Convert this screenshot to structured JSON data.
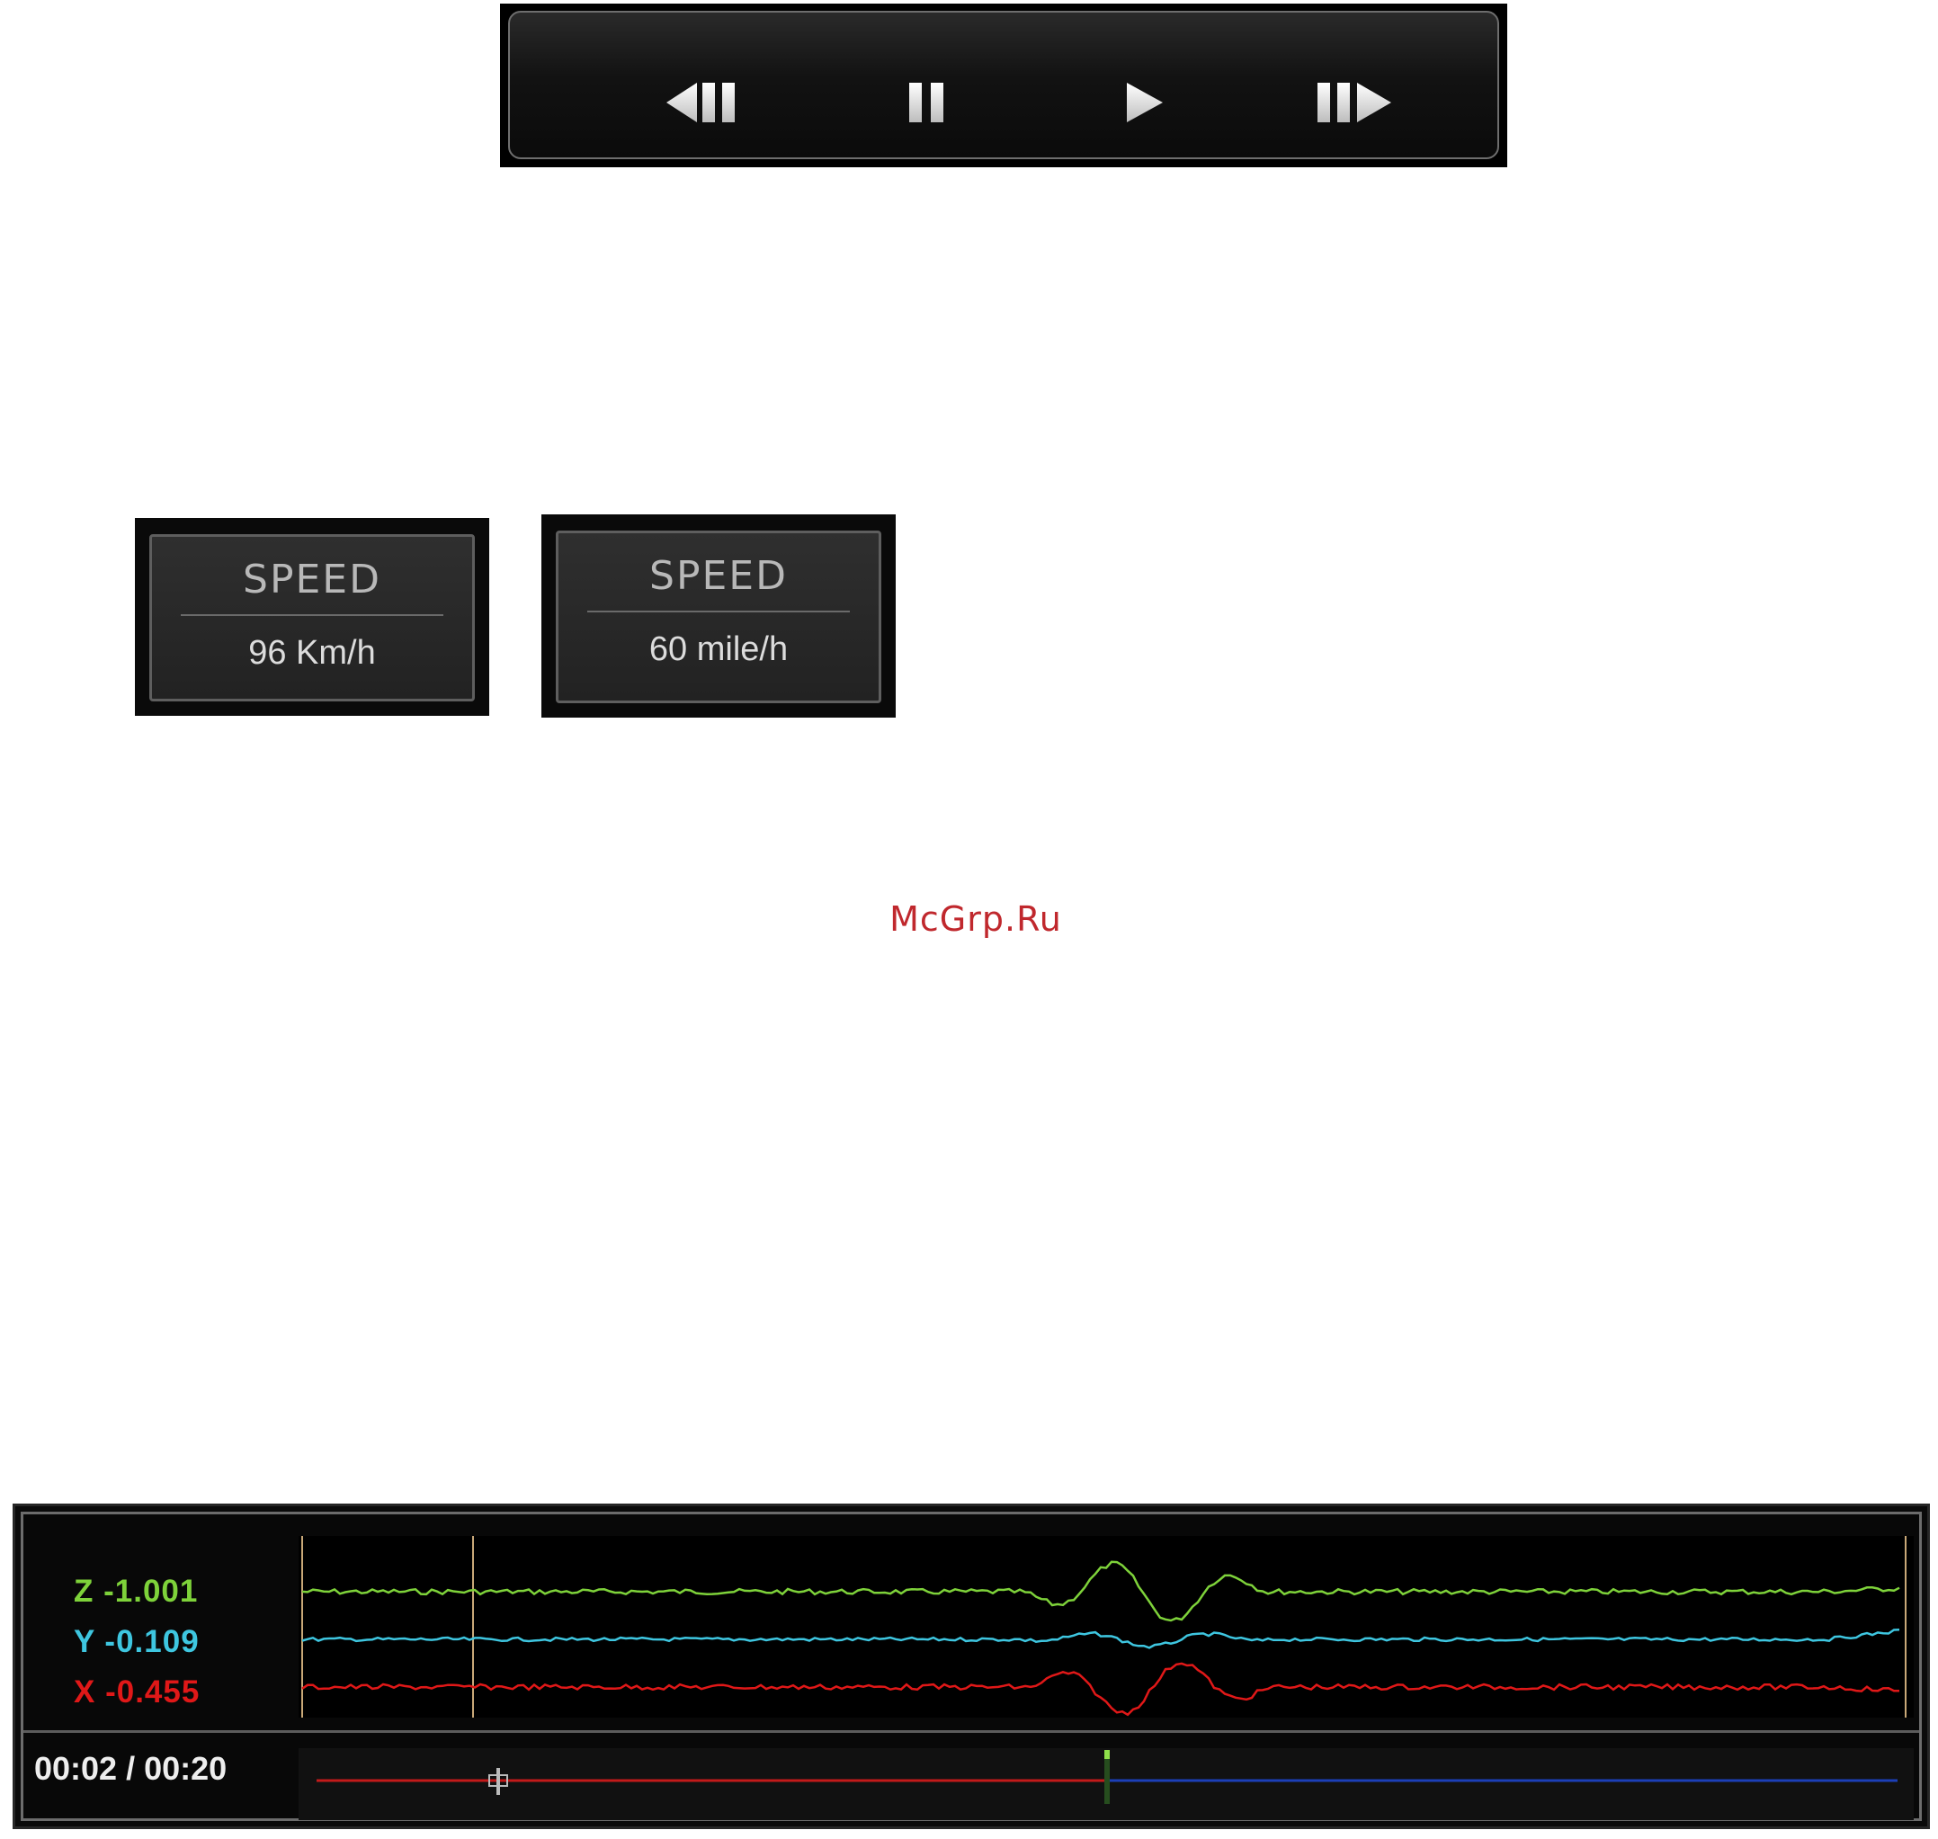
{
  "toolbar": {
    "buttons": [
      {
        "name": "step-back-button",
        "icon": "step-back-icon"
      },
      {
        "name": "pause-button",
        "icon": "pause-icon"
      },
      {
        "name": "play-button",
        "icon": "play-icon"
      },
      {
        "name": "step-forward-button",
        "icon": "step-forward-icon"
      }
    ]
  },
  "speed_boxes": [
    {
      "label": "SPEED",
      "value": "96 Km/h"
    },
    {
      "label": "SPEED",
      "value": "60 mile/h"
    }
  ],
  "watermark": "McGrp.Ru",
  "gsensor": {
    "z_label": "Z -1.001",
    "y_label": "Y -0.109",
    "x_label": "X -0.455",
    "colors": {
      "z": "#7ed23a",
      "y": "#3ec6e0",
      "x": "#e01818"
    },
    "time_display": "00:02 / 00:20",
    "progress_fraction": 0.5
  }
}
